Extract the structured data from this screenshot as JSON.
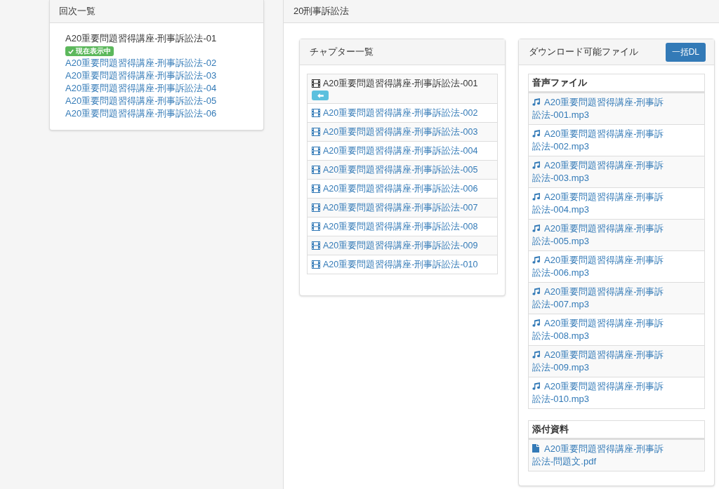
{
  "episodes_panel": {
    "title": "回次一覧",
    "items": [
      {
        "label": "A20重要問題習得講座-刑事訴訟法-01",
        "selected": true,
        "badge": "現在表示中"
      },
      {
        "label": "A20重要問題習得講座-刑事訴訟法-02",
        "selected": false
      },
      {
        "label": "A20重要問題習得講座-刑事訴訟法-03",
        "selected": false
      },
      {
        "label": "A20重要問題習得講座-刑事訴訟法-04",
        "selected": false
      },
      {
        "label": "A20重要問題習得講座-刑事訴訟法-05",
        "selected": false
      },
      {
        "label": "A20重要問題習得講座-刑事訴訟法-06",
        "selected": false
      }
    ]
  },
  "main": {
    "title": "20刑事訴訟法",
    "chapters_panel": {
      "title": "チャプター一覧",
      "items": [
        {
          "label": "A20重要問題習得講座-刑事訴訟法-001",
          "selected": true
        },
        {
          "label": "A20重要問題習得講座-刑事訴訟法-002",
          "selected": false
        },
        {
          "label": "A20重要問題習得講座-刑事訴訟法-003",
          "selected": false
        },
        {
          "label": "A20重要問題習得講座-刑事訴訟法-004",
          "selected": false
        },
        {
          "label": "A20重要問題習得講座-刑事訴訟法-005",
          "selected": false
        },
        {
          "label": "A20重要問題習得講座-刑事訴訟法-006",
          "selected": false
        },
        {
          "label": "A20重要問題習得講座-刑事訴訟法-007",
          "selected": false
        },
        {
          "label": "A20重要問題習得講座-刑事訴訟法-008",
          "selected": false
        },
        {
          "label": "A20重要問題習得講座-刑事訴訟法-009",
          "selected": false
        },
        {
          "label": "A20重要問題習得講座-刑事訴訟法-010",
          "selected": false
        }
      ]
    },
    "downloads_panel": {
      "title": "ダウンロード可能ファイル",
      "bulk_button": "一括DL",
      "sections": [
        {
          "title": "音声ファイル",
          "kind": "audio",
          "files": [
            "A20重要問題習得講座-刑事訴訟法-001.mp3",
            "A20重要問題習得講座-刑事訴訟法-002.mp3",
            "A20重要問題習得講座-刑事訴訟法-003.mp3",
            "A20重要問題習得講座-刑事訴訟法-004.mp3",
            "A20重要問題習得講座-刑事訴訟法-005.mp3",
            "A20重要問題習得講座-刑事訴訟法-006.mp3",
            "A20重要問題習得講座-刑事訴訟法-007.mp3",
            "A20重要問題習得講座-刑事訴訟法-008.mp3",
            "A20重要問題習得講座-刑事訴訟法-009.mp3",
            "A20重要問題習得講座-刑事訴訟法-010.mp3"
          ]
        },
        {
          "title": "添付資料",
          "kind": "document",
          "files": [
            "A20重要問題習得講座-刑事訴訟法-問題文.pdf"
          ]
        }
      ]
    }
  }
}
